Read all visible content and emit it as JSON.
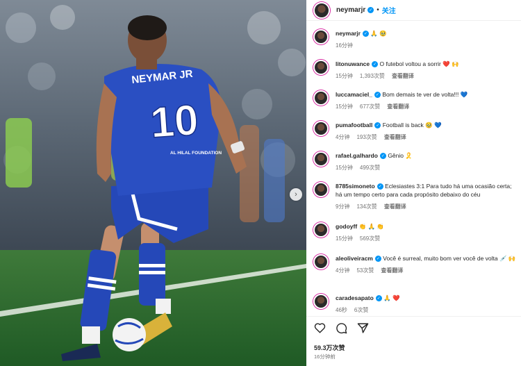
{
  "photo": {
    "jersey_name": "NEYMAR JR",
    "jersey_number": "10",
    "sponsor": "AL HILAL FOUNDATION"
  },
  "header": {
    "username": "neymarjr",
    "separator": "•",
    "follow_label": "关注"
  },
  "comments": [
    {
      "user": "neymarjr",
      "text": "🙏 🥹",
      "time": "16分钟",
      "likes": "",
      "translate": ""
    },
    {
      "user": "litonuwance",
      "text": "O futebol voltou a sorrir ❤️ 🙌",
      "time": "15分钟",
      "likes": "1,393次赞",
      "translate": "查看翻译"
    },
    {
      "user": "luccamaciel_",
      "text": "Bom demais te ver de volta!!! 💙",
      "time": "15分钟",
      "likes": "677次赞",
      "translate": "查看翻译"
    },
    {
      "user": "pumafootball",
      "text": "Football is back 🥹 💙",
      "time": "4分钟",
      "likes": "193次赞",
      "translate": "查看翻译"
    },
    {
      "user": "rafael.galhardo",
      "text": "Gênio 🎗️",
      "time": "15分钟",
      "likes": "499次赞",
      "translate": ""
    },
    {
      "user": "8785simoneto",
      "text": "Eclesiastes 3:1 Para tudo há uma ocasião certa; há um tempo certo para cada propósito debaixo do céu",
      "time": "9分钟",
      "likes": "134次赞",
      "translate": "查看翻译"
    },
    {
      "user": "godoyff",
      "text": "👏 🙏 👏",
      "time": "15分钟",
      "likes": "569次赞",
      "translate": ""
    },
    {
      "user": "aleoliveiracm",
      "text": "Você é surreal, muito bom ver você de volta 💉 🙌",
      "time": "4分钟",
      "likes": "53次赞",
      "translate": "查看翻译"
    },
    {
      "user": "caradesapato",
      "text": "🙏 ❤️",
      "time": "46秒",
      "likes": "6次赞",
      "translate": ""
    }
  ],
  "footer": {
    "likes": "59.3万次赞",
    "time": "16分钟前"
  },
  "colors": {
    "accent": "#0095f6",
    "jersey": "#2548b8"
  }
}
